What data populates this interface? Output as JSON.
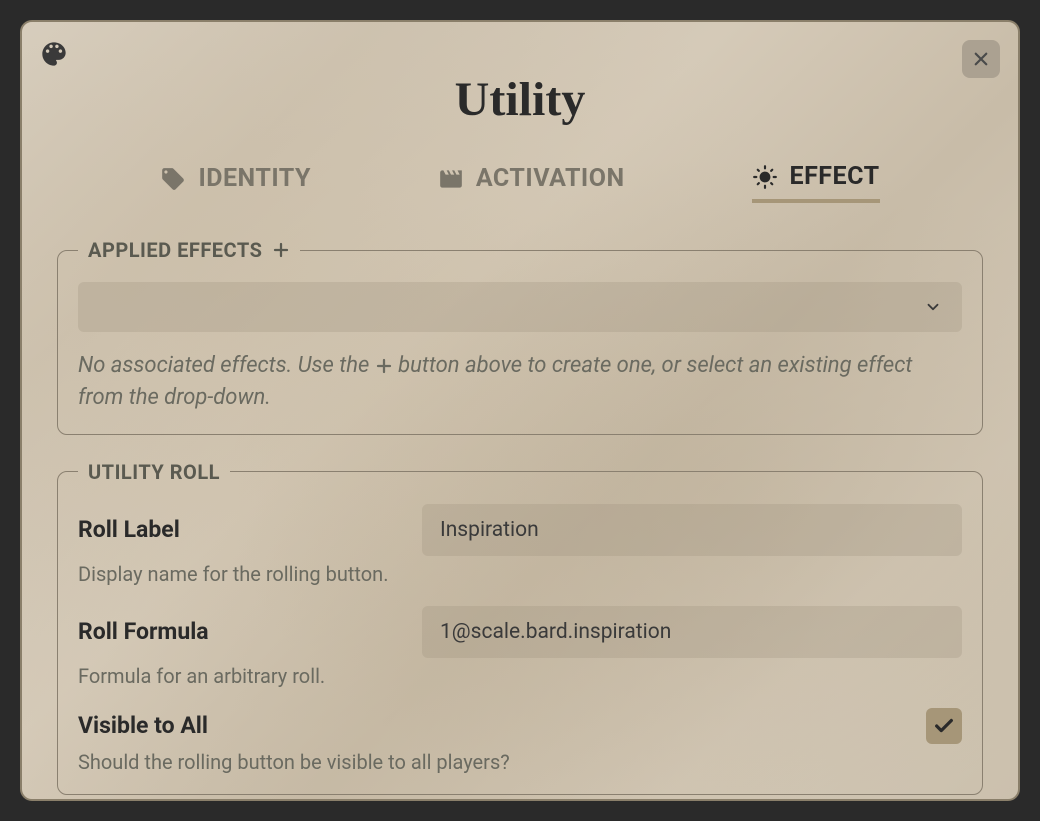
{
  "title": "Utility",
  "tabs": {
    "identity": "IDENTITY",
    "activation": "ACTIVATION",
    "effect": "EFFECT"
  },
  "appliedEffects": {
    "legend": "APPLIED EFFECTS",
    "emptyMessagePrefix": "No associated effects. Use the ",
    "emptyMessageSuffix": " button above to create one, or select an existing effect from the drop-down."
  },
  "utilityRoll": {
    "legend": "UTILITY ROLL",
    "rollLabel": {
      "label": "Roll Label",
      "value": "Inspiration",
      "hint": "Display name for the rolling button."
    },
    "rollFormula": {
      "label": "Roll Formula",
      "value": "1@scale.bard.inspiration",
      "hint": "Formula for an arbitrary roll."
    },
    "visibleToAll": {
      "label": "Visible to All",
      "checked": true,
      "hint": "Should the rolling button be visible to all players?"
    }
  }
}
